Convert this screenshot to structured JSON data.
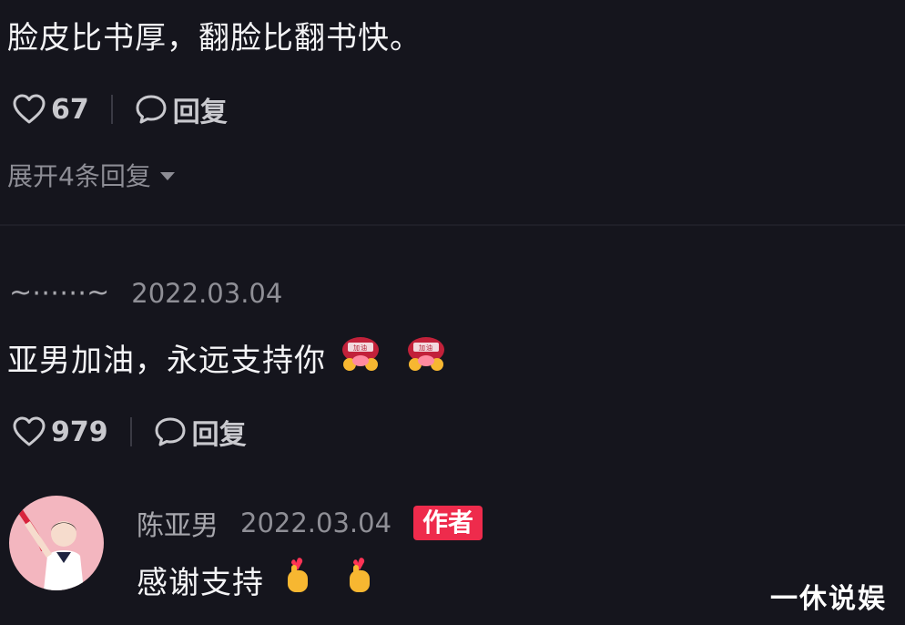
{
  "comment1": {
    "text": "脸皮比书厚，翻脸比翻书快。",
    "likes": "67",
    "reply_label": "回复",
    "expand_label": "展开4条回复"
  },
  "comment2": {
    "username": "~⋯⋯~",
    "date": "2022.03.04",
    "text": "亚男加油，永远支持你",
    "emojis": [
      "cheer-emoji",
      "cheer-emoji"
    ],
    "likes": "979",
    "reply_label": "回复"
  },
  "comment3": {
    "username": "陈亚男",
    "date": "2022.03.04",
    "badge": "作者",
    "text": "感谢支持",
    "emojis": [
      "finger-heart-emoji",
      "finger-heart-emoji"
    ]
  },
  "watermark": "一休说娱",
  "colors": {
    "background": "#15151d",
    "badge": "#ee2b4c",
    "muted_text": "#8d8d95"
  }
}
